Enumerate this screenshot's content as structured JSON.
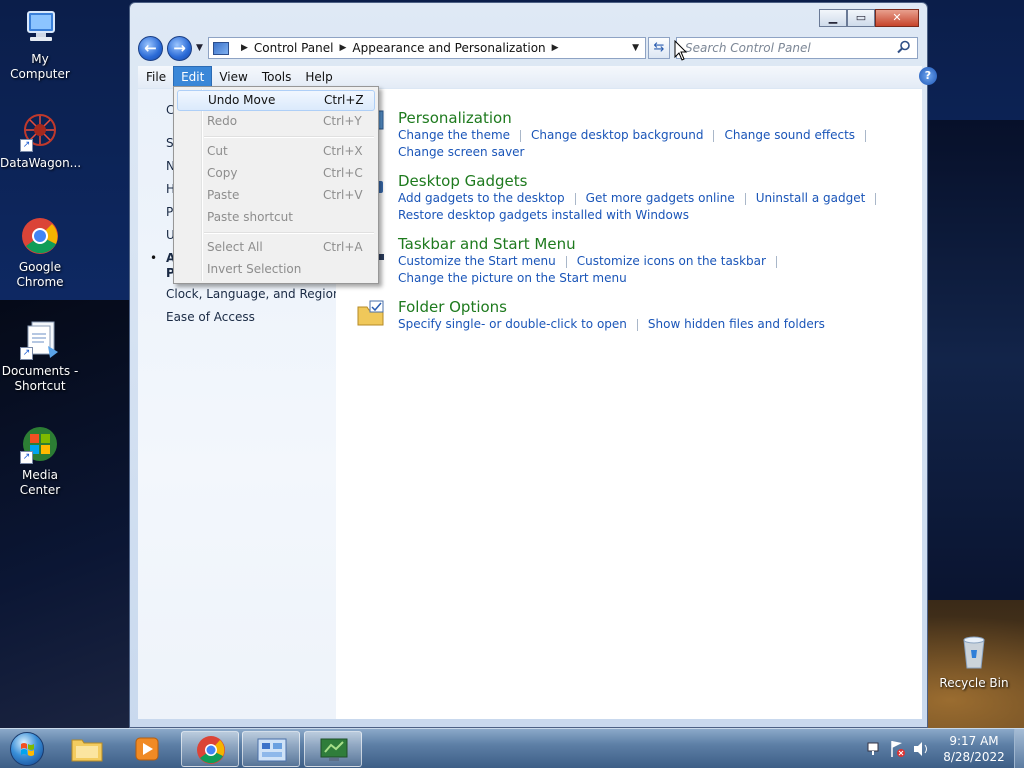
{
  "desktop": {
    "icons": [
      {
        "label": "My Computer"
      },
      {
        "label": "DataWagon..."
      },
      {
        "label": "Google Chrome"
      },
      {
        "label": "Documents - Shortcut"
      },
      {
        "label": "Media Center"
      },
      {
        "label": "Recycle Bin"
      }
    ]
  },
  "window": {
    "breadcrumb": [
      "Control Panel",
      "Appearance and Personalization"
    ],
    "search_placeholder": "Search Control Panel",
    "menu": [
      "File",
      "Edit",
      "View",
      "Tools",
      "Help"
    ],
    "active_menu": "Edit"
  },
  "edit_menu": {
    "items": [
      {
        "label": "Undo Move",
        "shortcut": "Ctrl+Z",
        "enabled": true
      },
      {
        "label": "Redo",
        "shortcut": "Ctrl+Y",
        "enabled": false
      },
      {
        "label": "Cut",
        "shortcut": "Ctrl+X",
        "enabled": false
      },
      {
        "label": "Copy",
        "shortcut": "Ctrl+C",
        "enabled": false
      },
      {
        "label": "Paste",
        "shortcut": "Ctrl+V",
        "enabled": false
      },
      {
        "label": "Paste shortcut",
        "shortcut": "",
        "enabled": false
      },
      {
        "label": "Select All",
        "shortcut": "Ctrl+A",
        "enabled": false
      },
      {
        "label": "Invert Selection",
        "shortcut": "",
        "enabled": false
      }
    ]
  },
  "left_pane": {
    "partial_items": [
      "C",
      "S",
      "N",
      "H",
      "P",
      "U",
      "A",
      "P"
    ],
    "items": [
      "Clock, Language, and Region",
      "Ease of Access"
    ]
  },
  "categories": [
    {
      "title": "Personalization",
      "links": [
        "Change the theme",
        "Change desktop background",
        "Change sound effects",
        "Change screen saver"
      ]
    },
    {
      "title": "Desktop Gadgets",
      "links": [
        "Add gadgets to the desktop",
        "Get more gadgets online",
        "Uninstall a gadget",
        "Restore desktop gadgets installed with Windows"
      ]
    },
    {
      "title": "Taskbar and Start Menu",
      "links": [
        "Customize the Start menu",
        "Customize icons on the taskbar",
        "Change the picture on the Start menu"
      ]
    },
    {
      "title": "Folder Options",
      "links": [
        "Specify single- or double-click to open",
        "Show hidden files and folders"
      ]
    }
  ],
  "taskbar": {
    "time": "9:17 AM",
    "date": "8/28/2022"
  },
  "colors": {
    "category_title": "#1e7a1e",
    "link": "#1a55b8",
    "menu_highlight": "#3a87d8"
  }
}
